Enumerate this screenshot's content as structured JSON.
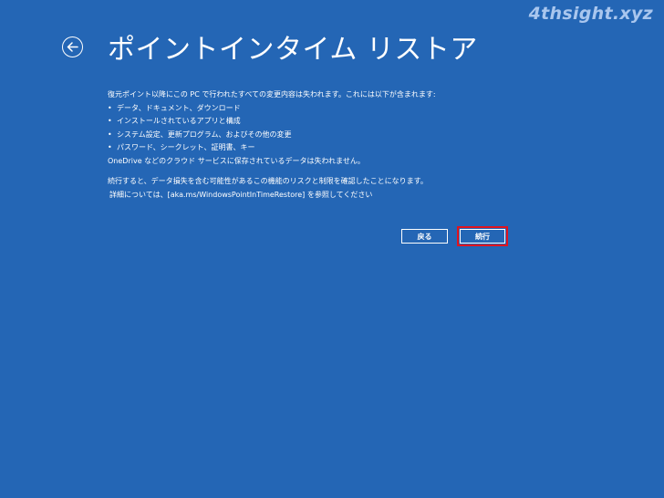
{
  "watermark": "4thsight.xyz",
  "header": {
    "back_icon": "arrow-left-circle-icon",
    "title": "ポイントインタイム リストア"
  },
  "content": {
    "intro": "復元ポイント以降にこの PC で行われたすべての変更内容は失われます。これには以下が含まれます:",
    "bullets": [
      "データ、ドキュメント、ダウンロード",
      "インストールされているアプリと構成",
      "システム設定、更新プログラム、およびその他の変更",
      "パスワード、シークレット、証明書、キー"
    ],
    "onedrive_note": "OneDrive などのクラウド サービスに保存されているデータは失われません。",
    "continue_note": "続行すると、データ損失を含む可能性があるこの機能のリスクと制限を確認したことになります。",
    "details_note": "詳細については、[aka.ms/WindowsPointInTimeRestore] を参照してください"
  },
  "buttons": {
    "back_label": "戻る",
    "continue_label": "続行"
  },
  "colors": {
    "background": "#2466b5",
    "text": "#ffffff",
    "highlight": "#e2141e"
  }
}
